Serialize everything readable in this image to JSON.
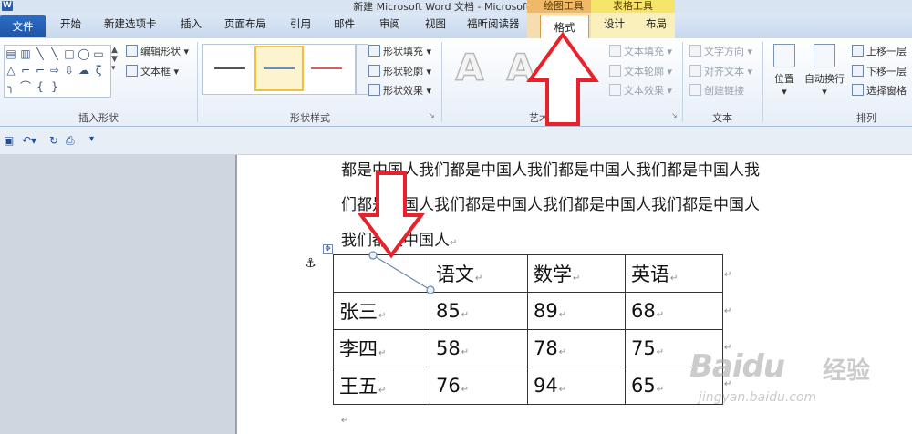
{
  "window": {
    "title": "新建 Microsoft Word 文档 - Microsoft Word",
    "app_logo": "W"
  },
  "tabs": {
    "file": "文件",
    "home": "开始",
    "new_tab": "新建选项卡",
    "insert": "插入",
    "page_layout": "页面布局",
    "references": "引用",
    "mailings": "邮件",
    "review": "审阅",
    "view": "视图",
    "foxit_reader": "福昕阅读器",
    "format": "格式",
    "design": "设计",
    "layout": "布局"
  },
  "context_tabs": {
    "drawing_tools": "绘图工具",
    "table_tools": "表格工具"
  },
  "ribbon": {
    "insert_shapes": {
      "label": "插入形状",
      "edit_shape": "编辑形状",
      "text_box": "文本框",
      "shape_glyphs": [
        "▤",
        "▥",
        "╲",
        "╲",
        "□",
        "◯",
        "▭",
        "△",
        "⌐",
        "⌐",
        "⇨",
        "⇩",
        "☁",
        "ζ",
        "╮",
        "⌒",
        "{",
        "}"
      ]
    },
    "shape_styles": {
      "label": "形状样式",
      "fill": "形状填充",
      "outline": "形状轮廓",
      "effects": "形状效果",
      "swatch_colors": [
        "#555555",
        "#6a8cc4",
        "#d45f5f"
      ]
    },
    "wordart": {
      "label": "艺术字样式",
      "letters": [
        "A",
        "A"
      ],
      "text_fill": "文本填充",
      "text_outline": "文本轮廓",
      "text_effects": "文本效果"
    },
    "text": {
      "label": "文本",
      "direction": "文字方向",
      "align": "对齐文本",
      "link": "创建链接"
    },
    "arrange": {
      "label": "排列",
      "position": "位置",
      "wrap": "自动换行",
      "bring_forward": "上移一层",
      "send_backward": "下移一层",
      "selection_pane": "选择窗格"
    }
  },
  "quick_access": [
    "save-icon",
    "undo-icon",
    "redo-icon",
    "print-preview-icon",
    "customize-icon"
  ],
  "document": {
    "paragraph_lines": [
      "都是中国人我们都是中国人我们都是中国人我们都是中国人我",
      "们都是中国人我们都是中国人我们都是中国人我们都是中国人",
      "我们都是中国人"
    ],
    "table": {
      "header": [
        "",
        "语文",
        "数学",
        "英语"
      ],
      "rows": [
        [
          "张三",
          "85",
          "89",
          "68"
        ],
        [
          "李四",
          "58",
          "78",
          "75"
        ],
        [
          "王五",
          "76",
          "94",
          "65"
        ]
      ]
    },
    "para_mark": "↵",
    "anchor": "⚓",
    "table_handle": "✥"
  },
  "watermark": {
    "brand": "Baidu",
    "cn": "经验",
    "url": "jingyan.baidu.com"
  },
  "colors": {
    "arrow": "#e8212a",
    "file_tab": "#2b6cc4",
    "context_drawing": "#f0b96a",
    "context_table": "#f6e56b"
  }
}
